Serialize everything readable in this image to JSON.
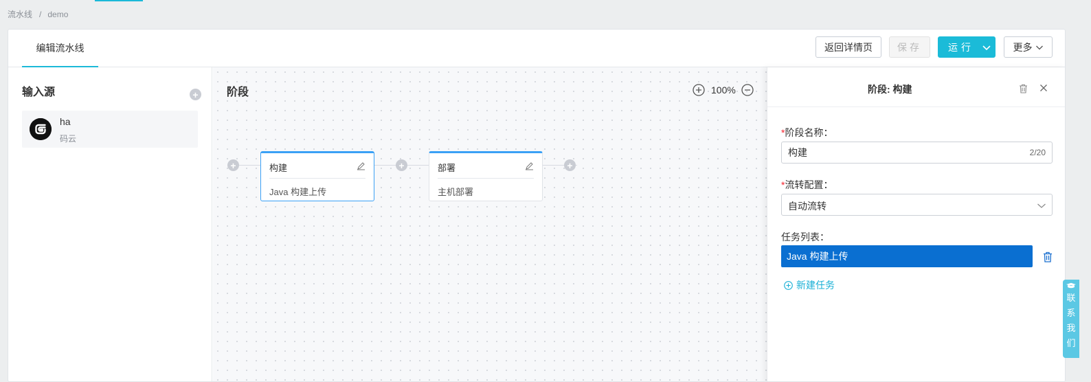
{
  "breadcrumb": {
    "root": "流水线",
    "separator": "/",
    "current": "demo"
  },
  "header": {
    "tab_label": "编辑流水线",
    "back_button": "返回详情页",
    "save_button": "保存",
    "run_button": "运行",
    "more_button": "更多"
  },
  "sources": {
    "title": "输入源",
    "items": [
      {
        "name": "ha",
        "type": "码云",
        "icon": "gitee-logo-icon"
      }
    ]
  },
  "canvas": {
    "title": "阶段",
    "zoom": "100%",
    "stages": [
      {
        "name": "构建",
        "task": "Java 构建上传",
        "active": true
      },
      {
        "name": "部署",
        "task": "主机部署",
        "active": false
      }
    ]
  },
  "panel": {
    "title": "阶段: 构建",
    "stage_name_label": "阶段名称：",
    "stage_name_value": "构建",
    "stage_name_count": "2/20",
    "flow_label": "流转配置：",
    "flow_value": "自动流转",
    "task_list_label": "任务列表：",
    "tasks": [
      "Java 构建上传"
    ],
    "new_task": "新建任务",
    "required_mark": "*"
  },
  "contact": {
    "chars": [
      "联",
      "系",
      "我",
      "们"
    ]
  },
  "colors": {
    "accent": "#1bbbd8",
    "stage_top": "#3aa0f5",
    "task_selected": "#0a6fd1",
    "required": "#f5222d"
  }
}
